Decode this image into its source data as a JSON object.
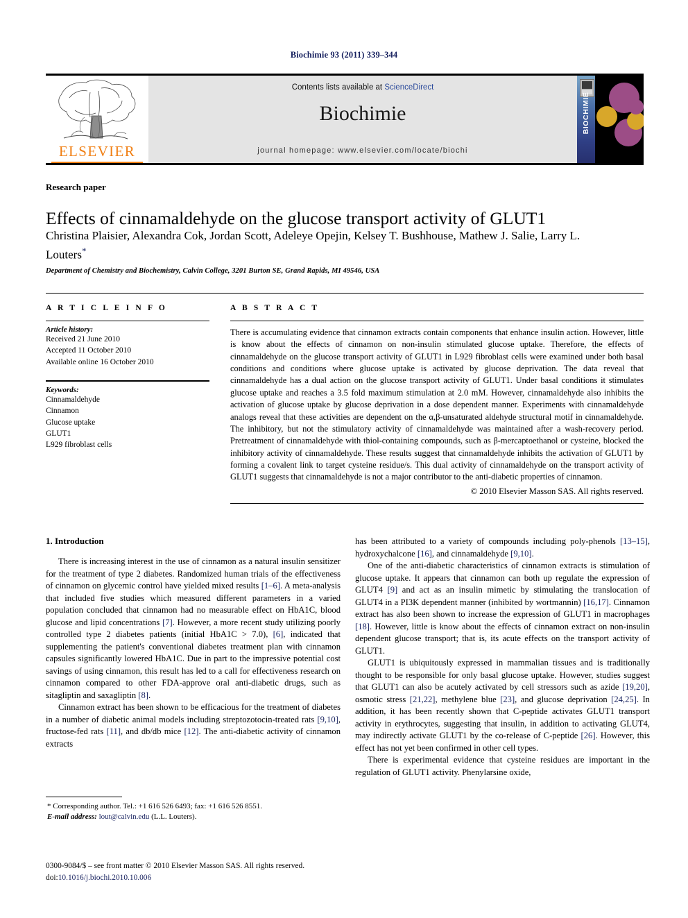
{
  "running_head": "Biochimie 93 (2011) 339–344",
  "masthead": {
    "publisher_logo_text": "ELSEVIER",
    "contents_prefix": "Contents lists available at",
    "contents_link": "ScienceDirect",
    "journal_title": "Biochimie",
    "homepage": "journal homepage: www.elsevier.com/locate/biochi",
    "cover_spine_text": "BIOCHIMIE",
    "link_color": "#2b4a9b",
    "logo_color": "#f07f13",
    "banner_bg": "#e4e4e4"
  },
  "article": {
    "type_label": "Research paper",
    "title": "Effects of cinnamaldehyde on the glucose transport activity of GLUT1",
    "authors": "Christina Plaisier, Alexandra Cok, Jordan Scott, Adeleye Opejin, Kelsey T. Bushhouse, Mathew J. Salie, Larry L. Louters",
    "corresponding_marker": "*",
    "affiliation": "Department of Chemistry and Biochemistry, Calvin College, 3201 Burton SE, Grand Rapids, MI 49546, USA"
  },
  "article_info": {
    "heading": "A R T I C L E  I N F O",
    "history_label": "Article history:",
    "history": [
      "Received 21 June 2010",
      "Accepted 11 October 2010",
      "Available online 16 October 2010"
    ],
    "keywords_label": "Keywords:",
    "keywords": [
      "Cinnamaldehyde",
      "Cinnamon",
      "Glucose uptake",
      "GLUT1",
      "L929 fibroblast cells"
    ]
  },
  "abstract": {
    "heading": "A B S T R A C T",
    "text": "There is accumulating evidence that cinnamon extracts contain components that enhance insulin action. However, little is know about the effects of cinnamon on non-insulin stimulated glucose uptake. Therefore, the effects of cinnamaldehyde on the glucose transport activity of GLUT1 in L929 fibroblast cells were examined under both basal conditions and conditions where glucose uptake is activated by glucose deprivation. The data reveal that cinnamaldehyde has a dual action on the glucose transport activity of GLUT1. Under basal conditions it stimulates glucose uptake and reaches a 3.5 fold maximum stimulation at 2.0 mM. However, cinnamaldehyde also inhibits the activation of glucose uptake by glucose deprivation in a dose dependent manner. Experiments with cinnamaldehyde analogs reveal that these activities are dependent on the α,β-unsaturated aldehyde structural motif in cinnamaldehyde. The inhibitory, but not the stimulatory activity of cinnamaldehyde was maintained after a wash-recovery period. Pretreatment of cinnamaldehyde with thiol-containing compounds, such as β-mercaptoethanol or cysteine, blocked the inhibitory activity of cinnamaldehyde. These results suggest that cinnamaldehyde inhibits the activation of GLUT1 by forming a covalent link to target cysteine residue/s. This dual activity of cinnamaldehyde on the transport activity of GLUT1 suggests that cinnamaldehyde is not a major contributor to the anti-diabetic properties of cinnamon.",
    "copyright": "© 2010 Elsevier Masson SAS. All rights reserved."
  },
  "body": {
    "section_heading": "1.  Introduction",
    "left_paragraphs": [
      {
        "segments": [
          {
            "t": "There is increasing interest in the use of cinnamon as a natural insulin sensitizer for the treatment of type 2 diabetes. Randomized human trials of the effectiveness of cinnamon on glycemic control have yielded mixed results "
          },
          {
            "t": "[1–6]",
            "ref": true
          },
          {
            "t": ". A meta-analysis that included five studies which measured different parameters in a varied population concluded that cinnamon had no measurable effect on HbA1C, blood glucose and lipid concentrations "
          },
          {
            "t": "[7]",
            "ref": true
          },
          {
            "t": ". However, a more recent study utilizing poorly controlled type 2 diabetes patients (initial HbA1C > 7.0), "
          },
          {
            "t": "[6]",
            "ref": true
          },
          {
            "t": ", indicated that supplementing the patient's conventional diabetes treatment plan with cinnamon capsules significantly lowered HbA1C. Due in part to the impressive potential cost savings of using cinnamon, this result has led to a call for effectiveness research on cinnamon compared to other FDA-approve oral anti-diabetic drugs, such as sitagliptin and saxagliptin "
          },
          {
            "t": "[8]",
            "ref": true
          },
          {
            "t": "."
          }
        ]
      },
      {
        "segments": [
          {
            "t": "Cinnamon extract has been shown to be efficacious for the treatment of diabetes in a number of diabetic animal models including streptozotocin-treated rats "
          },
          {
            "t": "[9,10]",
            "ref": true
          },
          {
            "t": ", fructose-fed rats "
          },
          {
            "t": "[11]",
            "ref": true
          },
          {
            "t": ", and db/db mice "
          },
          {
            "t": "[12]",
            "ref": true
          },
          {
            "t": ". The anti-diabetic activity of cinnamon extracts"
          }
        ]
      }
    ],
    "right_paragraphs": [
      {
        "continuation": true,
        "segments": [
          {
            "t": "has been attributed to a variety of compounds including poly-phenols "
          },
          {
            "t": "[13–15]",
            "ref": true
          },
          {
            "t": ", hydroxychalcone "
          },
          {
            "t": "[16]",
            "ref": true
          },
          {
            "t": ", and cinnamaldehyde "
          },
          {
            "t": "[9,10]",
            "ref": true
          },
          {
            "t": "."
          }
        ]
      },
      {
        "segments": [
          {
            "t": "One of the anti-diabetic characteristics of cinnamon extracts is stimulation of glucose uptake. It appears that cinnamon can both up regulate the expression of GLUT4 "
          },
          {
            "t": "[9]",
            "ref": true
          },
          {
            "t": " and act as an insulin mimetic by stimulating the translocation of GLUT4 in a PI3K dependent manner (inhibited by wortmannin) "
          },
          {
            "t": "[16,17]",
            "ref": true
          },
          {
            "t": ". Cinnamon extract has also been shown to increase the expression of GLUT1 in macrophages "
          },
          {
            "t": "[18]",
            "ref": true
          },
          {
            "t": ". However, little is know about the effects of cinnamon extract on non-insulin dependent glucose transport; that is, its acute effects on the transport activity of GLUT1."
          }
        ]
      },
      {
        "segments": [
          {
            "t": "GLUT1 is ubiquitously expressed in mammalian tissues and is traditionally thought to be responsible for only basal glucose uptake. However, studies suggest that GLUT1 can also be acutely activated by cell stressors such as azide "
          },
          {
            "t": "[19,20]",
            "ref": true
          },
          {
            "t": ", osmotic stress "
          },
          {
            "t": "[21,22]",
            "ref": true
          },
          {
            "t": ", methylene blue "
          },
          {
            "t": "[23]",
            "ref": true
          },
          {
            "t": ", and glucose deprivation "
          },
          {
            "t": "[24,25]",
            "ref": true
          },
          {
            "t": ". In addition, it has been recently shown that C-peptide activates GLUT1 transport activity in erythrocytes, suggesting that insulin, in addition to activating GLUT4, may indirectly activate GLUT1 by the co-release of C-peptide "
          },
          {
            "t": "[26]",
            "ref": true
          },
          {
            "t": ". However, this effect has not yet been confirmed in other cell types."
          }
        ]
      },
      {
        "segments": [
          {
            "t": "There is experimental evidence that cysteine residues are important in the regulation of GLUT1 activity. Phenylarsine oxide,"
          }
        ]
      }
    ]
  },
  "footnote": {
    "corresponding": "* Corresponding author. Tel.: +1 616 526 6493; fax: +1 616 526 8551.",
    "email_label": "E-mail address:",
    "email": "lout@calvin.edu",
    "email_owner": "(L.L. Louters)."
  },
  "imprint": {
    "line1": "0300-9084/$ – see front matter © 2010 Elsevier Masson SAS. All rights reserved.",
    "doi_label": "doi:",
    "doi": "10.1016/j.biochi.2010.10.006"
  }
}
